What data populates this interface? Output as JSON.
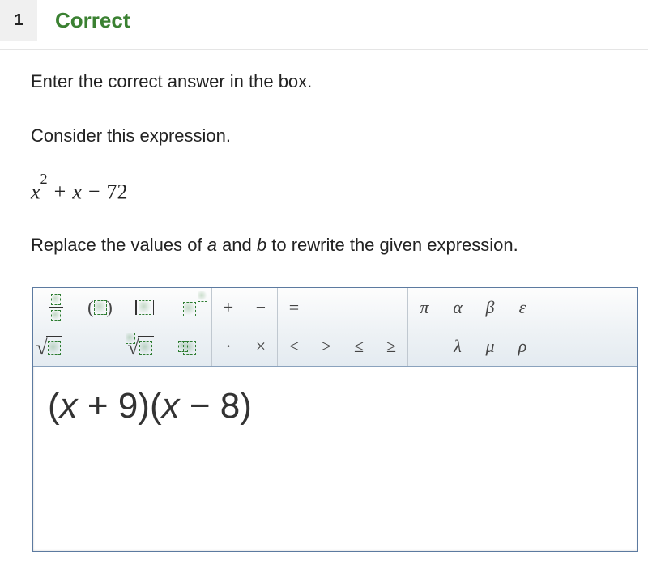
{
  "question": {
    "number": "1",
    "status": "Correct",
    "prompt": "Enter the correct answer in the box.",
    "consider": "Consider this expression.",
    "expression": {
      "latex": "x^2 + x − 72"
    },
    "replace_prefix": "Replace the values of ",
    "var_a": "a",
    "mid": " and ",
    "var_b": "b",
    "replace_suffix": " to rewrite the given expression."
  },
  "toolbar": {
    "fraction": "fraction",
    "parentheses": "parentheses",
    "absolute": "absolute value",
    "exponent": "exponent",
    "sqrt": "square root",
    "nthroot": "nth root",
    "subscript": "subscript",
    "ops": {
      "plus": "+",
      "minus": "−",
      "equals": "=",
      "dot": "·",
      "times": "×",
      "lt": "<",
      "gt": ">",
      "le": "≤",
      "ge": "≥"
    },
    "pi": "π",
    "greek": {
      "alpha": "α",
      "beta": "β",
      "epsilon": "ε",
      "lambda": "λ",
      "mu": "μ",
      "rho": "ρ"
    }
  },
  "answer": {
    "lp1": "(",
    "x1": "x",
    "plus": " + ",
    "a": "9",
    "rp1": ")",
    "lp2": "(",
    "x2": "x",
    "minus": " − ",
    "b": "8",
    "rp2": ")"
  }
}
